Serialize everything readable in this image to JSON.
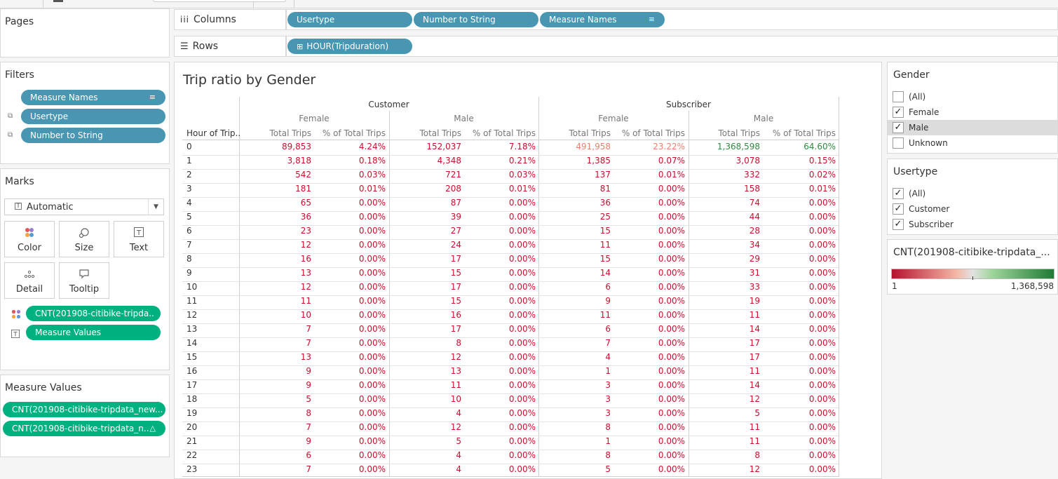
{
  "shelves": {
    "columns_label": "Columns",
    "rows_label": "Rows",
    "columns": [
      {
        "label": "Usertype"
      },
      {
        "label": "Number to String"
      },
      {
        "label": "Measure Names",
        "sort_icon": "sort-descending-icon"
      }
    ],
    "rows": [
      {
        "label": "HOUR(Tripduration)",
        "icon": "plus-box-icon"
      }
    ]
  },
  "pages": {
    "title": "Pages"
  },
  "filters": {
    "title": "Filters",
    "items": [
      {
        "label": "Measure Names",
        "icon": "sort-descending-icon"
      },
      {
        "label": "Usertype",
        "icon": "linked-icon"
      },
      {
        "label": "Number to String",
        "icon": "linked-icon"
      }
    ]
  },
  "marks": {
    "title": "Marks",
    "mark_type": "Automatic",
    "buttons": [
      {
        "label": "Color",
        "icon": "color-icon"
      },
      {
        "label": "Size",
        "icon": "size-icon"
      },
      {
        "label": "Text",
        "icon": "text-icon"
      },
      {
        "label": "Detail",
        "icon": "detail-icon"
      },
      {
        "label": "Tooltip",
        "icon": "tooltip-icon"
      }
    ],
    "fields": [
      {
        "label": "CNT(201908-citibike-tripda..",
        "icon": "color-icon"
      },
      {
        "label": "Measure Values",
        "icon": "text-icon"
      }
    ]
  },
  "measure_values": {
    "title": "Measure Values",
    "items": [
      {
        "label": "CNT(201908-citibike-tripdata_new..."
      },
      {
        "label": "CNT(201908-citibike-tripdata_n..",
        "icon": "delta-icon"
      }
    ]
  },
  "viz": {
    "title": "Trip ratio by Gender",
    "row_header": "Hour of Trip..",
    "usertypes": [
      "Customer",
      "Subscriber"
    ],
    "genders": [
      "Female",
      "Male",
      "Female",
      "Male"
    ],
    "measures": [
      "Total Trips",
      "% of Total Trips",
      "Total Trips",
      "% of Total Trips",
      "Total Trips",
      "% of Total Trips",
      "Total Trips",
      "% of Total Trips"
    ],
    "rows": [
      {
        "hour": "0",
        "cells": [
          "89,853",
          "4.24%",
          "152,037",
          "7.18%",
          "491,958",
          "23.22%",
          "1,368,598",
          "64.60%"
        ]
      },
      {
        "hour": "1",
        "cells": [
          "3,818",
          "0.18%",
          "4,348",
          "0.21%",
          "1,385",
          "0.07%",
          "3,078",
          "0.15%"
        ]
      },
      {
        "hour": "2",
        "cells": [
          "542",
          "0.03%",
          "721",
          "0.03%",
          "137",
          "0.01%",
          "332",
          "0.02%"
        ]
      },
      {
        "hour": "3",
        "cells": [
          "181",
          "0.01%",
          "208",
          "0.01%",
          "81",
          "0.00%",
          "158",
          "0.01%"
        ]
      },
      {
        "hour": "4",
        "cells": [
          "65",
          "0.00%",
          "87",
          "0.00%",
          "36",
          "0.00%",
          "74",
          "0.00%"
        ]
      },
      {
        "hour": "5",
        "cells": [
          "36",
          "0.00%",
          "39",
          "0.00%",
          "25",
          "0.00%",
          "44",
          "0.00%"
        ]
      },
      {
        "hour": "6",
        "cells": [
          "23",
          "0.00%",
          "27",
          "0.00%",
          "15",
          "0.00%",
          "28",
          "0.00%"
        ]
      },
      {
        "hour": "7",
        "cells": [
          "12",
          "0.00%",
          "24",
          "0.00%",
          "11",
          "0.00%",
          "34",
          "0.00%"
        ]
      },
      {
        "hour": "8",
        "cells": [
          "16",
          "0.00%",
          "17",
          "0.00%",
          "15",
          "0.00%",
          "29",
          "0.00%"
        ]
      },
      {
        "hour": "9",
        "cells": [
          "13",
          "0.00%",
          "15",
          "0.00%",
          "14",
          "0.00%",
          "31",
          "0.00%"
        ]
      },
      {
        "hour": "10",
        "cells": [
          "12",
          "0.00%",
          "17",
          "0.00%",
          "6",
          "0.00%",
          "33",
          "0.00%"
        ]
      },
      {
        "hour": "11",
        "cells": [
          "11",
          "0.00%",
          "15",
          "0.00%",
          "9",
          "0.00%",
          "19",
          "0.00%"
        ]
      },
      {
        "hour": "12",
        "cells": [
          "10",
          "0.00%",
          "16",
          "0.00%",
          "11",
          "0.00%",
          "11",
          "0.00%"
        ]
      },
      {
        "hour": "13",
        "cells": [
          "7",
          "0.00%",
          "17",
          "0.00%",
          "6",
          "0.00%",
          "14",
          "0.00%"
        ]
      },
      {
        "hour": "14",
        "cells": [
          "7",
          "0.00%",
          "8",
          "0.00%",
          "7",
          "0.00%",
          "17",
          "0.00%"
        ]
      },
      {
        "hour": "15",
        "cells": [
          "13",
          "0.00%",
          "12",
          "0.00%",
          "4",
          "0.00%",
          "17",
          "0.00%"
        ]
      },
      {
        "hour": "16",
        "cells": [
          "9",
          "0.00%",
          "13",
          "0.00%",
          "1",
          "0.00%",
          "11",
          "0.00%"
        ]
      },
      {
        "hour": "17",
        "cells": [
          "9",
          "0.00%",
          "11",
          "0.00%",
          "3",
          "0.00%",
          "14",
          "0.00%"
        ]
      },
      {
        "hour": "18",
        "cells": [
          "5",
          "0.00%",
          "10",
          "0.00%",
          "3",
          "0.00%",
          "12",
          "0.00%"
        ]
      },
      {
        "hour": "19",
        "cells": [
          "8",
          "0.00%",
          "4",
          "0.00%",
          "3",
          "0.00%",
          "5",
          "0.00%"
        ]
      },
      {
        "hour": "20",
        "cells": [
          "7",
          "0.00%",
          "12",
          "0.00%",
          "8",
          "0.00%",
          "11",
          "0.00%"
        ]
      },
      {
        "hour": "21",
        "cells": [
          "9",
          "0.00%",
          "5",
          "0.00%",
          "1",
          "0.00%",
          "11",
          "0.00%"
        ]
      },
      {
        "hour": "22",
        "cells": [
          "6",
          "0.00%",
          "4",
          "0.00%",
          "8",
          "0.00%",
          "8",
          "0.00%"
        ]
      },
      {
        "hour": "23",
        "cells": [
          "7",
          "0.00%",
          "4",
          "0.00%",
          "5",
          "0.00%",
          "12",
          "0.00%"
        ]
      }
    ],
    "colors": {
      "low": "#c8102e",
      "mid": "#e8826e",
      "high": "#2e8b3e"
    }
  },
  "gender_filter": {
    "title": "Gender",
    "options": [
      {
        "label": "(All)",
        "checked": false
      },
      {
        "label": "Female",
        "checked": true
      },
      {
        "label": "Male",
        "checked": true,
        "highlight": true
      },
      {
        "label": "Unknown",
        "checked": false
      }
    ]
  },
  "usertype_filter": {
    "title": "Usertype",
    "options": [
      {
        "label": "(All)",
        "checked": true
      },
      {
        "label": "Customer",
        "checked": true
      },
      {
        "label": "Subscriber",
        "checked": true
      }
    ]
  },
  "legend": {
    "title": "CNT(201908-citibike-tripdata_...",
    "min": "1",
    "max": "1,368,598",
    "colors": [
      "#b5122f",
      "#f3b8a6",
      "#e2e2e2",
      "#9ed59a",
      "#1f7a34"
    ]
  }
}
